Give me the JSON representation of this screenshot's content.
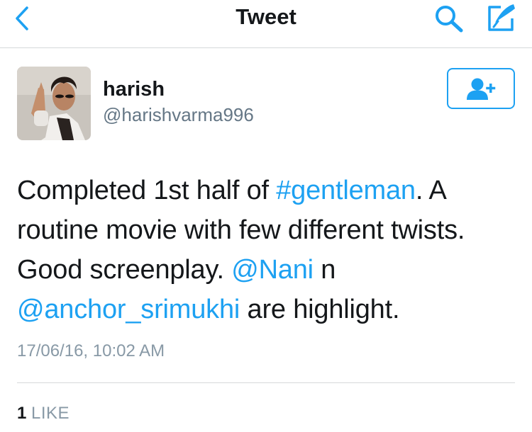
{
  "header": {
    "title": "Tweet",
    "back_icon": "chevron-left-icon",
    "search_icon": "search-icon",
    "compose_icon": "compose-icon",
    "accent_color": "#1da1f2"
  },
  "author": {
    "name": "harish",
    "handle": "@harishvarma996",
    "follow_icon": "follow-user-icon"
  },
  "tweet": {
    "text_parts": [
      "Completed 1st half of ",
      "#gentleman",
      ". A routine movie with few different twists. Good screenplay. ",
      "@Nani",
      " n ",
      "@anchor_srimukhi",
      " are highlight."
    ],
    "timestamp": "17/06/16, 10:02 AM"
  },
  "stats": {
    "likes_count": "1",
    "likes_label": "LIKE"
  }
}
